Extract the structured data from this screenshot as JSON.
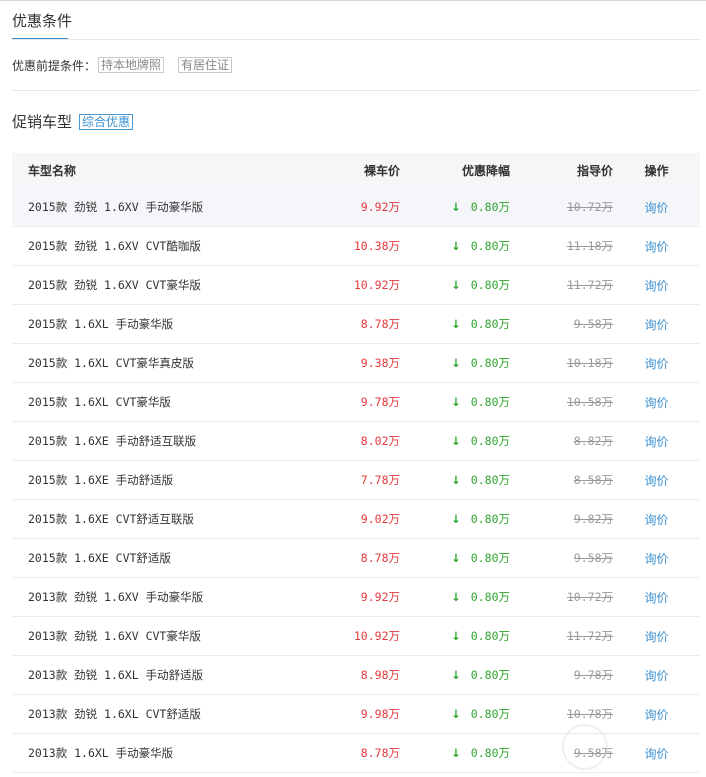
{
  "conditions": {
    "title": "优惠条件",
    "prereq_label": "优惠前提条件：",
    "tags": [
      "持本地牌照",
      "有居住证"
    ]
  },
  "promo": {
    "title": "促销车型",
    "tag": "综合优惠"
  },
  "table": {
    "headers": {
      "name": "车型名称",
      "bare_price": "裸车价",
      "discount": "优惠降幅",
      "guide_price": "指导价",
      "action": "操作"
    },
    "rows": [
      {
        "name": "2015款 劲锐 1.6XV 手动豪华版",
        "bare_price": "9.92万",
        "discount": "0.80万",
        "guide_price": "10.72万",
        "action": "询价"
      },
      {
        "name": "2015款 劲锐 1.6XV CVT酷咖版",
        "bare_price": "10.38万",
        "discount": "0.80万",
        "guide_price": "11.18万",
        "action": "询价"
      },
      {
        "name": "2015款 劲锐 1.6XV CVT豪华版",
        "bare_price": "10.92万",
        "discount": "0.80万",
        "guide_price": "11.72万",
        "action": "询价"
      },
      {
        "name": "2015款 1.6XL 手动豪华版",
        "bare_price": "8.78万",
        "discount": "0.80万",
        "guide_price": "9.58万",
        "action": "询价"
      },
      {
        "name": "2015款 1.6XL CVT豪华真皮版",
        "bare_price": "9.38万",
        "discount": "0.80万",
        "guide_price": "10.18万",
        "action": "询价"
      },
      {
        "name": "2015款 1.6XL CVT豪华版",
        "bare_price": "9.78万",
        "discount": "0.80万",
        "guide_price": "10.58万",
        "action": "询价"
      },
      {
        "name": "2015款 1.6XE 手动舒适互联版",
        "bare_price": "8.02万",
        "discount": "0.80万",
        "guide_price": "8.82万",
        "action": "询价"
      },
      {
        "name": "2015款 1.6XE 手动舒适版",
        "bare_price": "7.78万",
        "discount": "0.80万",
        "guide_price": "8.58万",
        "action": "询价"
      },
      {
        "name": "2015款 1.6XE CVT舒适互联版",
        "bare_price": "9.02万",
        "discount": "0.80万",
        "guide_price": "9.82万",
        "action": "询价"
      },
      {
        "name": "2015款 1.6XE CVT舒适版",
        "bare_price": "8.78万",
        "discount": "0.80万",
        "guide_price": "9.58万",
        "action": "询价"
      },
      {
        "name": "2013款 劲锐 1.6XV 手动豪华版",
        "bare_price": "9.92万",
        "discount": "0.80万",
        "guide_price": "10.72万",
        "action": "询价"
      },
      {
        "name": "2013款 劲锐 1.6XV CVT豪华版",
        "bare_price": "10.92万",
        "discount": "0.80万",
        "guide_price": "11.72万",
        "action": "询价"
      },
      {
        "name": "2013款 劲锐 1.6XL 手动舒适版",
        "bare_price": "8.98万",
        "discount": "0.80万",
        "guide_price": "9.78万",
        "action": "询价"
      },
      {
        "name": "2013款 劲锐 1.6XL CVT舒适版",
        "bare_price": "9.98万",
        "discount": "0.80万",
        "guide_price": "10.78万",
        "action": "询价"
      },
      {
        "name": "2013款 1.6XL 手动豪华版",
        "bare_price": "8.78万",
        "discount": "0.80万",
        "guide_price": "9.58万",
        "action": "询价"
      }
    ]
  },
  "colors": {
    "accent": "#3a8fd0",
    "price_red": "#e4393c",
    "discount_green": "#2fa52f",
    "muted": "#999999"
  },
  "icons": {
    "discount_arrow": "down-arrow-icon"
  }
}
